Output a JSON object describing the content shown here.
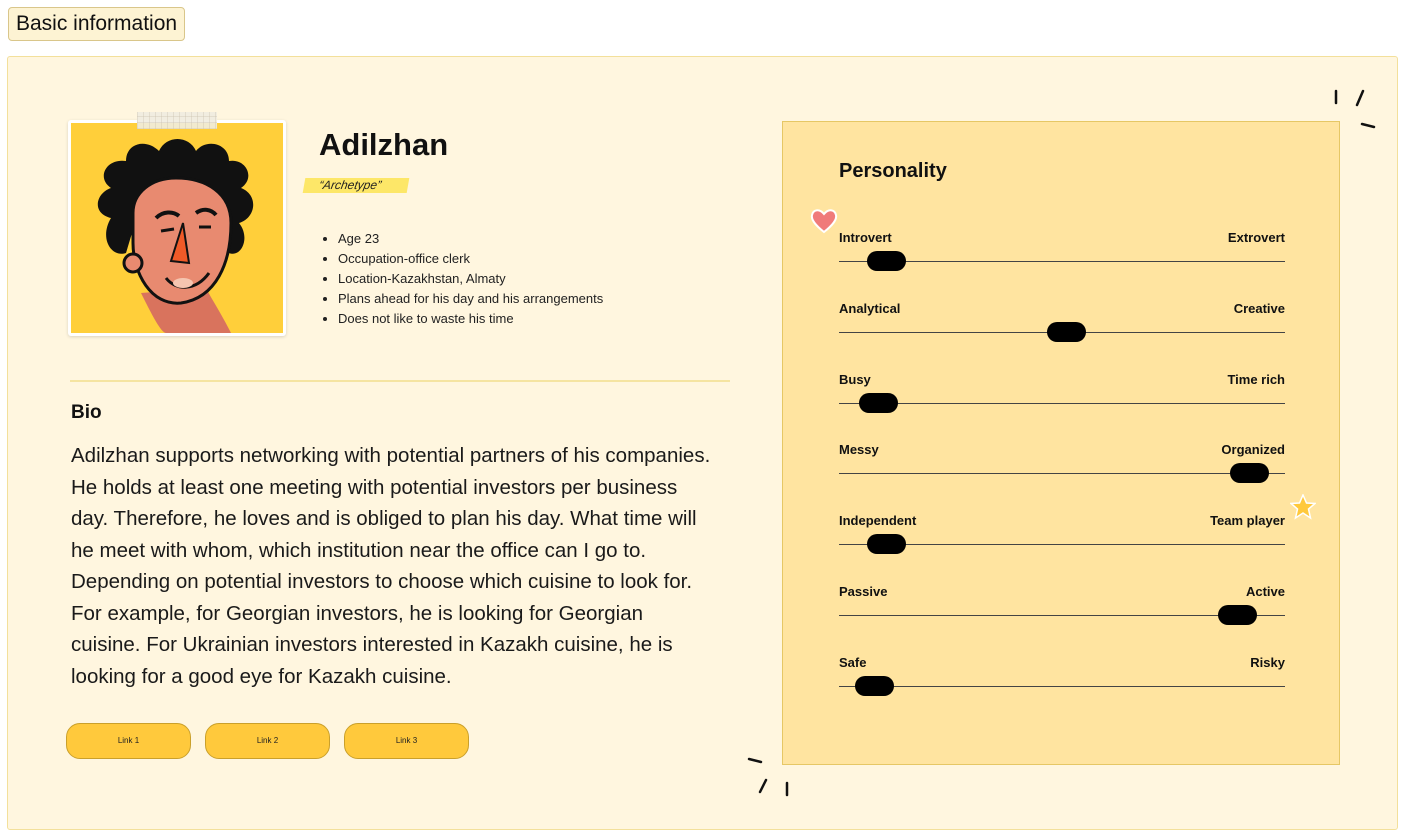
{
  "section_tag": "Basic information",
  "persona": {
    "name": "Adilzhan",
    "archetype": "“Archetype”",
    "facts": [
      "Age 23",
      "Occupation-office clerk",
      "Location-Kazakhstan, Almaty",
      "Plans ahead for his day and his arrangements",
      "Does not like to waste his time"
    ]
  },
  "bio": {
    "title": "Bio",
    "text": "Adilzhan supports networking with potential partners of his companies. He holds at least one meeting with potential investors per business day. Therefore, he loves and is obliged to plan his day. What time will he meet with whom, which institution near the office can I go to. Depending on potential investors to choose which cuisine to look for. For example, for Georgian investors, he is looking for Georgian cuisine. For Ukrainian investors interested in Kazakh cuisine, he is looking for a good eye for Kazakh cuisine."
  },
  "links": [
    "Link 1",
    "Link 2",
    "Link 3"
  ],
  "personality": {
    "title": "Personality",
    "traits": [
      {
        "left": "Introvert",
        "right": "Extrovert",
        "value": 0.07
      },
      {
        "left": "Analytical",
        "right": "Creative",
        "value": 0.51
      },
      {
        "left": "Busy",
        "right": "Time rich",
        "value": 0.05
      },
      {
        "left": "Messy",
        "right": "Organized",
        "value": 0.96
      },
      {
        "left": "Independent",
        "right": "Team player",
        "value": 0.07
      },
      {
        "left": "Passive",
        "right": "Active",
        "value": 0.93
      },
      {
        "left": "Safe",
        "right": "Risky",
        "value": 0.04
      }
    ]
  },
  "colors": {
    "accent_yellow": "#ffc93c",
    "panel_bg": "#fff6df",
    "card_bg": "#ffe4a0",
    "heart": "#f07a7a",
    "star": "#ffc93c"
  }
}
